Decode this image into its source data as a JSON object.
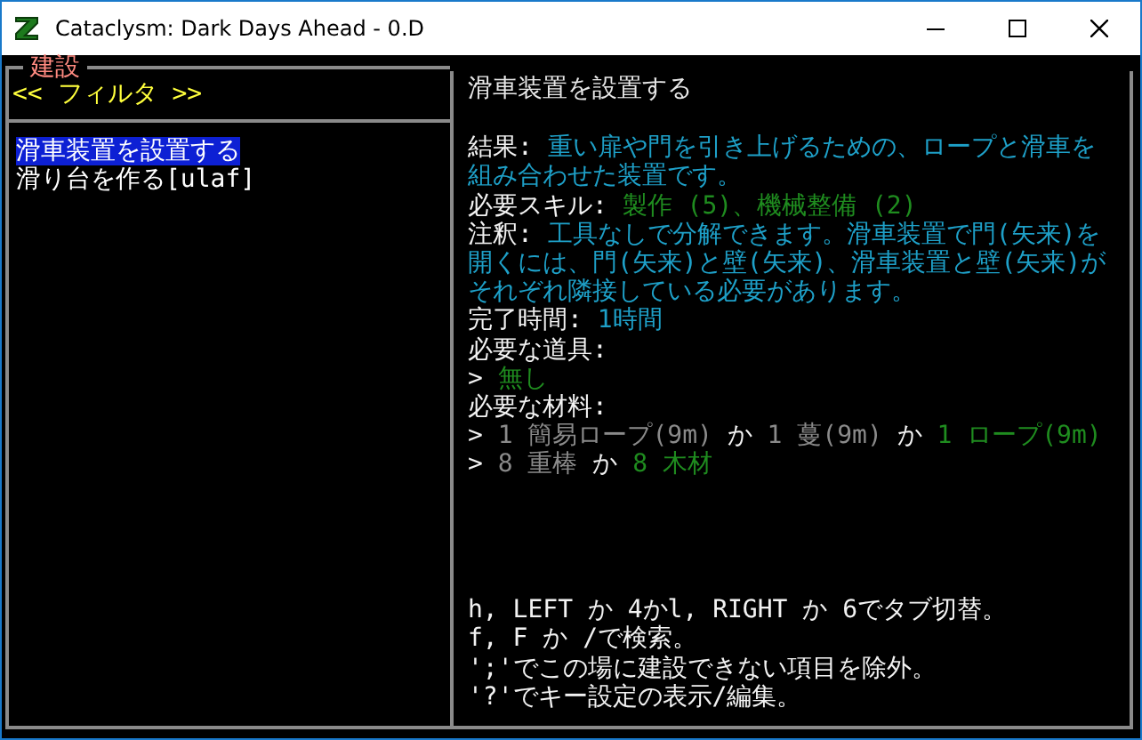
{
  "window": {
    "title": "Cataclysm: Dark Days Ahead - 0.D"
  },
  "panel": {
    "title": "建設",
    "filter": "<< フィルタ >>",
    "items": [
      {
        "label": "滑車装置を設置する",
        "selected": true
      },
      {
        "label": "滑り台を作る[ulaf]",
        "selected": false
      }
    ]
  },
  "detail": {
    "heading": "滑車装置を設置する",
    "lines": [
      {
        "segments": [
          {
            "text": "結果: ",
            "kind": "plain"
          },
          {
            "text": "重い扉や門を引き上げるための、ロープと滑車を組み合わせた装置です。",
            "kind": "info"
          }
        ]
      },
      {
        "segments": [
          {
            "text": "必要スキル: ",
            "kind": "plain"
          },
          {
            "text": "製作 (5)、",
            "kind": "available"
          },
          {
            "text": "機械整備 (2)",
            "kind": "available"
          }
        ]
      },
      {
        "segments": [
          {
            "text": "注釈: ",
            "kind": "plain"
          },
          {
            "text": "工具なしで分解できます。滑車装置で門(矢来)を開くには、門(矢来)と壁(矢来)、滑車装置と壁(矢来)がそれぞれ隣接している必要があります。",
            "kind": "info"
          }
        ]
      },
      {
        "segments": [
          {
            "text": "完了時間: ",
            "kind": "plain"
          },
          {
            "text": "1時間",
            "kind": "info"
          }
        ]
      },
      {
        "segments": [
          {
            "text": "必要な道具:",
            "kind": "plain"
          }
        ]
      },
      {
        "segments": [
          {
            "text": "> ",
            "kind": "plain"
          },
          {
            "text": "無し",
            "kind": "available"
          }
        ]
      },
      {
        "segments": [
          {
            "text": "必要な材料:",
            "kind": "plain"
          }
        ]
      },
      {
        "segments": [
          {
            "text": "> ",
            "kind": "plain"
          },
          {
            "text": "1 簡易ロープ(9m)",
            "kind": "unavailable"
          },
          {
            "text": " か ",
            "kind": "plain"
          },
          {
            "text": "1 蔓(9m)",
            "kind": "unavailable"
          },
          {
            "text": " か ",
            "kind": "plain"
          },
          {
            "text": "1 ロープ(9m)",
            "kind": "available"
          }
        ]
      },
      {
        "segments": [
          {
            "text": "> ",
            "kind": "plain"
          },
          {
            "text": "8 重棒",
            "kind": "unavailable"
          },
          {
            "text": " か ",
            "kind": "plain"
          },
          {
            "text": "8 木材",
            "kind": "available"
          }
        ]
      }
    ],
    "help": [
      "h, LEFT か 4かl, RIGHT か 6でタブ切替。",
      "f, F か /で検索。",
      "';'でこの場に建設できない項目を除外。",
      "'?'でキー設定の表示/編集。"
    ]
  }
}
